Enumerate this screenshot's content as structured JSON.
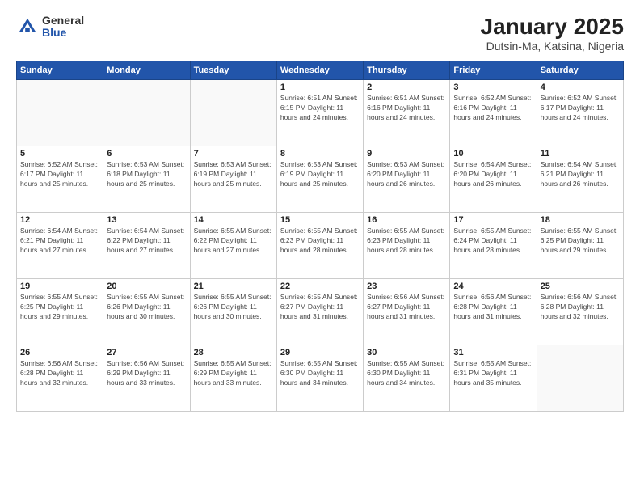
{
  "header": {
    "logo_general": "General",
    "logo_blue": "Blue",
    "month_title": "January 2025",
    "location": "Dutsin-Ma, Katsina, Nigeria"
  },
  "weekdays": [
    "Sunday",
    "Monday",
    "Tuesday",
    "Wednesday",
    "Thursday",
    "Friday",
    "Saturday"
  ],
  "weeks": [
    [
      {
        "day": "",
        "info": "",
        "empty": true
      },
      {
        "day": "",
        "info": "",
        "empty": true
      },
      {
        "day": "",
        "info": "",
        "empty": true
      },
      {
        "day": "1",
        "info": "Sunrise: 6:51 AM\nSunset: 6:15 PM\nDaylight: 11 hours\nand 24 minutes."
      },
      {
        "day": "2",
        "info": "Sunrise: 6:51 AM\nSunset: 6:16 PM\nDaylight: 11 hours\nand 24 minutes."
      },
      {
        "day": "3",
        "info": "Sunrise: 6:52 AM\nSunset: 6:16 PM\nDaylight: 11 hours\nand 24 minutes."
      },
      {
        "day": "4",
        "info": "Sunrise: 6:52 AM\nSunset: 6:17 PM\nDaylight: 11 hours\nand 24 minutes."
      }
    ],
    [
      {
        "day": "5",
        "info": "Sunrise: 6:52 AM\nSunset: 6:17 PM\nDaylight: 11 hours\nand 25 minutes."
      },
      {
        "day": "6",
        "info": "Sunrise: 6:53 AM\nSunset: 6:18 PM\nDaylight: 11 hours\nand 25 minutes."
      },
      {
        "day": "7",
        "info": "Sunrise: 6:53 AM\nSunset: 6:19 PM\nDaylight: 11 hours\nand 25 minutes."
      },
      {
        "day": "8",
        "info": "Sunrise: 6:53 AM\nSunset: 6:19 PM\nDaylight: 11 hours\nand 25 minutes."
      },
      {
        "day": "9",
        "info": "Sunrise: 6:53 AM\nSunset: 6:20 PM\nDaylight: 11 hours\nand 26 minutes."
      },
      {
        "day": "10",
        "info": "Sunrise: 6:54 AM\nSunset: 6:20 PM\nDaylight: 11 hours\nand 26 minutes."
      },
      {
        "day": "11",
        "info": "Sunrise: 6:54 AM\nSunset: 6:21 PM\nDaylight: 11 hours\nand 26 minutes."
      }
    ],
    [
      {
        "day": "12",
        "info": "Sunrise: 6:54 AM\nSunset: 6:21 PM\nDaylight: 11 hours\nand 27 minutes."
      },
      {
        "day": "13",
        "info": "Sunrise: 6:54 AM\nSunset: 6:22 PM\nDaylight: 11 hours\nand 27 minutes."
      },
      {
        "day": "14",
        "info": "Sunrise: 6:55 AM\nSunset: 6:22 PM\nDaylight: 11 hours\nand 27 minutes."
      },
      {
        "day": "15",
        "info": "Sunrise: 6:55 AM\nSunset: 6:23 PM\nDaylight: 11 hours\nand 28 minutes."
      },
      {
        "day": "16",
        "info": "Sunrise: 6:55 AM\nSunset: 6:23 PM\nDaylight: 11 hours\nand 28 minutes."
      },
      {
        "day": "17",
        "info": "Sunrise: 6:55 AM\nSunset: 6:24 PM\nDaylight: 11 hours\nand 28 minutes."
      },
      {
        "day": "18",
        "info": "Sunrise: 6:55 AM\nSunset: 6:25 PM\nDaylight: 11 hours\nand 29 minutes."
      }
    ],
    [
      {
        "day": "19",
        "info": "Sunrise: 6:55 AM\nSunset: 6:25 PM\nDaylight: 11 hours\nand 29 minutes."
      },
      {
        "day": "20",
        "info": "Sunrise: 6:55 AM\nSunset: 6:26 PM\nDaylight: 11 hours\nand 30 minutes."
      },
      {
        "day": "21",
        "info": "Sunrise: 6:55 AM\nSunset: 6:26 PM\nDaylight: 11 hours\nand 30 minutes."
      },
      {
        "day": "22",
        "info": "Sunrise: 6:55 AM\nSunset: 6:27 PM\nDaylight: 11 hours\nand 31 minutes."
      },
      {
        "day": "23",
        "info": "Sunrise: 6:56 AM\nSunset: 6:27 PM\nDaylight: 11 hours\nand 31 minutes."
      },
      {
        "day": "24",
        "info": "Sunrise: 6:56 AM\nSunset: 6:28 PM\nDaylight: 11 hours\nand 31 minutes."
      },
      {
        "day": "25",
        "info": "Sunrise: 6:56 AM\nSunset: 6:28 PM\nDaylight: 11 hours\nand 32 minutes."
      }
    ],
    [
      {
        "day": "26",
        "info": "Sunrise: 6:56 AM\nSunset: 6:28 PM\nDaylight: 11 hours\nand 32 minutes."
      },
      {
        "day": "27",
        "info": "Sunrise: 6:56 AM\nSunset: 6:29 PM\nDaylight: 11 hours\nand 33 minutes."
      },
      {
        "day": "28",
        "info": "Sunrise: 6:55 AM\nSunset: 6:29 PM\nDaylight: 11 hours\nand 33 minutes."
      },
      {
        "day": "29",
        "info": "Sunrise: 6:55 AM\nSunset: 6:30 PM\nDaylight: 11 hours\nand 34 minutes."
      },
      {
        "day": "30",
        "info": "Sunrise: 6:55 AM\nSunset: 6:30 PM\nDaylight: 11 hours\nand 34 minutes."
      },
      {
        "day": "31",
        "info": "Sunrise: 6:55 AM\nSunset: 6:31 PM\nDaylight: 11 hours\nand 35 minutes."
      },
      {
        "day": "",
        "info": "",
        "empty": true
      }
    ]
  ]
}
